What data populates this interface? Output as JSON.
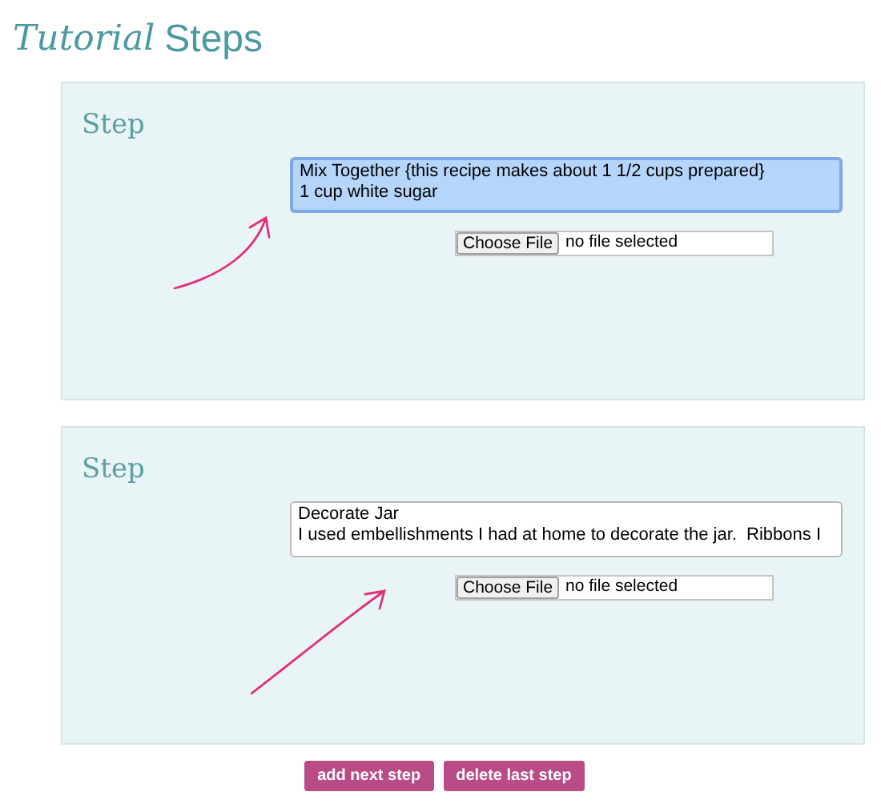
{
  "title": {
    "script_part": "Tutorial",
    "plain_part": "Steps"
  },
  "steps": [
    {
      "heading": "Step",
      "text_lines": [
        "Mix Together {this recipe makes about 1 1/2 cups prepared}",
        "1 cup white sugar"
      ],
      "focused": true,
      "file_button": "Choose File",
      "file_status": "no file selected"
    },
    {
      "heading": "Step",
      "text_lines": [
        "Decorate Jar",
        "I used embellishments I had at home to decorate the jar.  Ribbons I"
      ],
      "focused": false,
      "file_button": "Choose File",
      "file_status": "no file selected"
    }
  ],
  "buttons": [
    "add next step",
    "delete last step"
  ]
}
